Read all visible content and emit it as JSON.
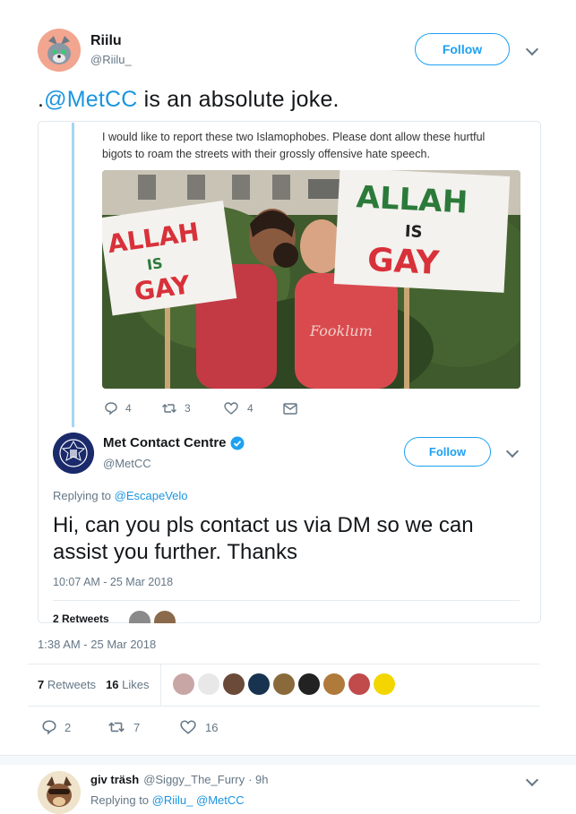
{
  "tweet": {
    "author_name": "Riilu",
    "author_handle": "@Riilu_",
    "follow_label": "Follow",
    "text_prefix": ".",
    "text_mention": "@MetCC",
    "text_rest": " is an absolute joke.",
    "timestamp": "1:38 AM - 25 Mar 2018",
    "retweets_count": "7",
    "retweets_label": "Retweets",
    "likes_count": "16",
    "likes_label": "Likes",
    "reply_count": "2",
    "retweet_action_count": "7",
    "like_action_count": "16",
    "avatar_colors": [
      "#c9a6a6",
      "#e8e8e8",
      "#6b4a3a",
      "#17334f",
      "#8a6a3b",
      "#222222",
      "#b07a3b",
      "#c14a4a",
      "#f3d600"
    ]
  },
  "quoted_parent": {
    "text": "I would like to report these two Islamophobes.  Please dont allow these hurtful bigots to roam the streets with their grossly offensive hate speech.",
    "sign_left": [
      "ALLAH",
      "IS",
      "GAY"
    ],
    "sign_right": [
      "ALLAH",
      "IS",
      "GAY"
    ],
    "shirt_text": "Fooklum",
    "reply_count": "4",
    "retweet_count": "3",
    "like_count": "4"
  },
  "quoted": {
    "author_name": "Met Contact Centre",
    "author_handle": "@MetCC",
    "follow_label": "Follow",
    "replying_prefix": "Replying to ",
    "replying_to": "@EscapeVelo",
    "text": "Hi, can you pls contact us via DM so we can assist you further. Thanks",
    "timestamp": "10:07 AM - 25 Mar 2018",
    "retweets_label": "2 Retweets"
  },
  "reply": {
    "author_name": "giv träsh",
    "author_handle": "@Siggy_The_Furry",
    "time": "· 9h",
    "replying_prefix": "Replying to ",
    "replying_to_1": "@Riilu_",
    "replying_to_2": "@MetCC"
  },
  "colors": {
    "accent": "#1da1f2",
    "link": "#1b95e0",
    "muted": "#657786",
    "verified": "#1da1f2",
    "thread_line": "#a6d5f2"
  }
}
